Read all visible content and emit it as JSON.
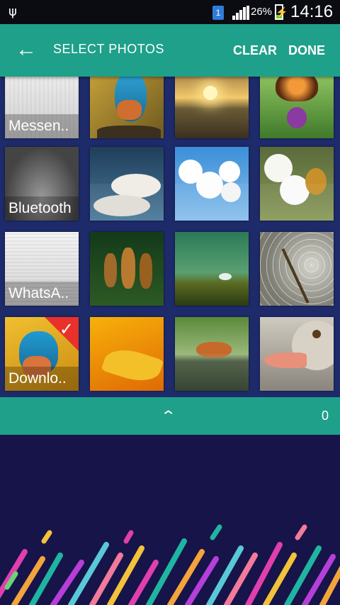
{
  "status_bar": {
    "battery_percent": "26%",
    "time": "14:16",
    "sim_label": "1",
    "icons": [
      "usb-icon",
      "sim-icon",
      "signal-icon",
      "battery-charging-icon"
    ]
  },
  "app_bar": {
    "title": "SELECT PHOTOS",
    "clear_label": "CLEAR",
    "done_label": "DONE",
    "back_icon": "arrow-back-icon"
  },
  "albums": [
    {
      "label": "Messen..",
      "colors": [
        "#f0f0f0",
        "#bdbdbd"
      ]
    },
    {
      "label": "Bluetooth",
      "colors": [
        "#bfbfbf",
        "#3c3c3c"
      ]
    },
    {
      "label": "WhatsA..",
      "colors": [
        "#f2f2f2",
        "#c8c8c8"
      ]
    },
    {
      "label": "Downlo..",
      "colors": [
        "#e9b21f",
        "#2a7fb7"
      ],
      "selected": true
    }
  ],
  "photos_row1": [
    {
      "name": "kingfisher-photo",
      "colors": [
        "#b08a2a",
        "#2b8bb3"
      ]
    },
    {
      "name": "sunset-photo",
      "colors": [
        "#f0c060",
        "#5a4a2a"
      ]
    },
    {
      "name": "butterfly-photo",
      "colors": [
        "#86c25a",
        "#c75a1a"
      ]
    }
  ],
  "photos_row2": [
    {
      "name": "clouds-photo",
      "colors": [
        "#2d5b7a",
        "#e8e8e8"
      ]
    },
    {
      "name": "cherry-blossom-photo",
      "colors": [
        "#5ba7e0",
        "#ffffff"
      ]
    },
    {
      "name": "bee-flower-photo",
      "colors": [
        "#7b8c4a",
        "#f2f2f2"
      ]
    }
  ],
  "photos_row3": [
    {
      "name": "pinecones-photo",
      "colors": [
        "#1f4a1d",
        "#8a5a1f"
      ]
    },
    {
      "name": "moss-photo",
      "colors": [
        "#3f8a58",
        "#6d7a2a"
      ]
    },
    {
      "name": "dragonfly-web-photo",
      "colors": [
        "#9a9a90",
        "#3a3a30"
      ]
    }
  ],
  "photos_row4": [
    {
      "name": "dewdrop-leaf-photo",
      "colors": [
        "#f5a20a",
        "#c0700a"
      ]
    },
    {
      "name": "fox-photo",
      "colors": [
        "#7fa060",
        "#3a4a30"
      ]
    },
    {
      "name": "goose-photo",
      "colors": [
        "#bdb7ad",
        "#e08a7a"
      ]
    }
  ],
  "bottom_bar": {
    "expand_icon": "chevron-up-icon",
    "selected_count": "0"
  },
  "check_icon": "checkmark-icon"
}
